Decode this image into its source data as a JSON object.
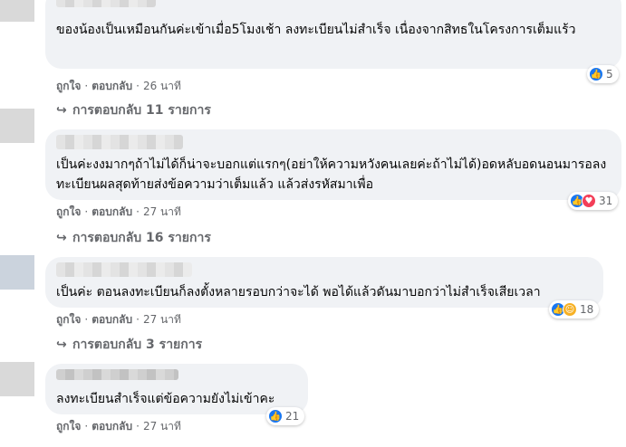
{
  "comments": [
    {
      "text": "ของน้องเป็นเหมือนกันค่ะเข้าเมื่อ5โมงเช้า ลงทะเบียนไม่สำเร็จ เนื่องจากสิทธในโครงการเต็มแร้ว",
      "like": "ถูกใจ",
      "reply": "ตอบกลับ",
      "time": "26 นาที",
      "replies": "การตอบกลับ 11 รายการ",
      "reactions": "5",
      "reaction_icons": [
        "like-icon"
      ]
    },
    {
      "text": "เป็นค่ะงงมากๆถ้าไม่ได้ก็น่าจะบอกแต่แรกๆ(อย่าให้ความหวังคนเลยค่ะถ้าไม่ได้)อดหลับอดนอนมารอลงทะเบียนผลสุดท้ายส่งข้อความว่าเต็มแล้ว แล้วส่งรหัสมาเพื่อ",
      "like": "ถูกใจ",
      "reply": "ตอบกลับ",
      "time": "27 นาที",
      "replies": "การตอบกลับ 16 รายการ",
      "reactions": "31",
      "reaction_icons": [
        "like-icon",
        "love-icon"
      ]
    },
    {
      "text": "เป็นค่ะ ตอนลงทะเบียนก็ลงตั้งหลายรอบกว่าจะได้ พอได้แล้วดันมาบอกว่าไม่สำเร็จเสียเวลา",
      "like": "ถูกใจ",
      "reply": "ตอบกลับ",
      "time": "27 นาที",
      "replies": "การตอบกลับ 3 รายการ",
      "reactions": "18",
      "reaction_icons": [
        "like-icon",
        "care-icon"
      ]
    },
    {
      "text": "ลงทะเบียนสำเร็จแต่ข้อความยังไม่เข้าคะ",
      "like": "ถูกใจ",
      "reply": "ตอบกลับ",
      "time": "27 นาที",
      "reactions": "21",
      "reaction_icons": [
        "like-icon"
      ]
    }
  ],
  "icons": {
    "reply_arrow": "reply-arrow-icon",
    "like_glyph": "👍",
    "love_glyph": "♥",
    "care_glyph": "☺"
  },
  "colors": {
    "like": "#1877f2",
    "love": "#f33e58",
    "care": "#f7b125",
    "bubble": "#f0f2f5",
    "meta": "#65676b"
  }
}
